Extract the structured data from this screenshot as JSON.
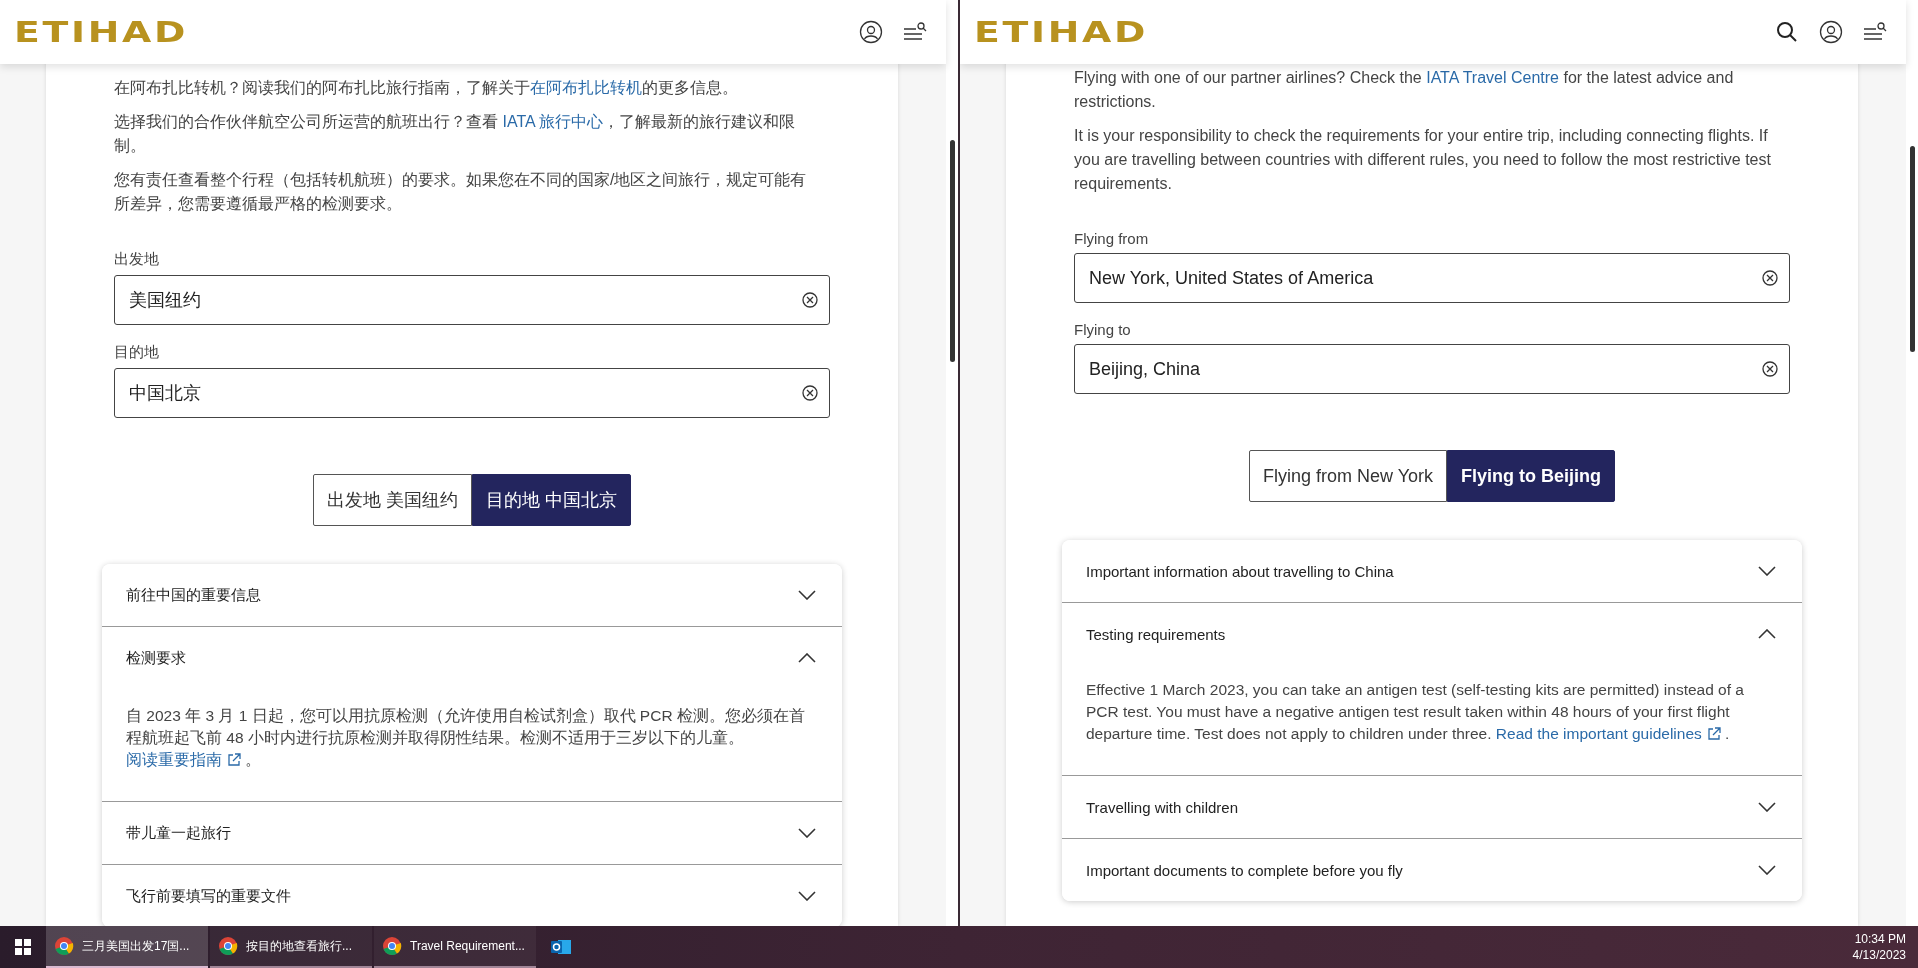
{
  "panes": [
    {
      "logo": "ETIHAD",
      "search_button": false,
      "paragraphs": [
        {
          "parts": [
            {
              "text": "在阿布扎比转机？阅读我们的阿布扎比旅行指南，了解关于",
              "link": false
            },
            {
              "text": "在阿布扎比转机",
              "link": true
            },
            {
              "text": "的更多信息。",
              "link": false
            }
          ]
        },
        {
          "parts": [
            {
              "text": "选择我们的合作伙伴航空公司所运营的航班出行？查看 ",
              "link": false
            },
            {
              "text": "IATA 旅行中心",
              "link": true
            },
            {
              "text": "，了解最新的旅行建议和限制。",
              "link": false
            }
          ]
        },
        {
          "parts": [
            {
              "text": "您有责任查看整个行程（包括转机航班）的要求。如果您在不同的国家/地区之间旅行，规定可能有所差异，您需要遵循最严格的检测要求。",
              "link": false
            }
          ]
        }
      ],
      "fields": [
        {
          "label": "出发地",
          "value": "美国纽约"
        },
        {
          "label": "目的地",
          "value": "中国北京"
        }
      ],
      "toggle": [
        {
          "label": "出发地 美国纽约",
          "selected": false
        },
        {
          "label": "目的地 中国北京",
          "selected": true
        }
      ],
      "accordion": [
        {
          "title": "前往中国的重要信息",
          "expanded": false
        },
        {
          "title": "检测要求",
          "expanded": true,
          "body": [
            {
              "text": "自 2023 年 3 月 1 日起，您可以用抗原检测（允许使用自检试剂盒）取代 PCR 检测。您必须在首程航班起飞前 48 小时内进行抗原检测并取得阴性结果。检测不适用于三岁以下的儿童。",
              "link": false
            },
            {
              "text": "阅读重要指南",
              "link": true,
              "external": true
            },
            {
              "text": " 。",
              "link": false
            }
          ]
        },
        {
          "title": "带儿童一起旅行",
          "expanded": false
        },
        {
          "title": "飞行前要填写的重要文件",
          "expanded": false
        }
      ]
    },
    {
      "logo": "ETIHAD",
      "search_button": true,
      "paragraphs": [
        {
          "parts": [
            {
              "text": "Flying with one of our partner airlines? Check the ",
              "link": false
            },
            {
              "text": "IATA Travel Centre",
              "link": true
            },
            {
              "text": " for the latest advice and restrictions.",
              "link": false
            }
          ]
        },
        {
          "parts": [
            {
              "text": "It is your responsibility to check the requirements for your entire trip, including connecting flights. If you are travelling between countries with different rules, you need to follow the most restrictive test requirements.",
              "link": false
            }
          ]
        }
      ],
      "fields": [
        {
          "label": "Flying from",
          "value": "New York, United States of America"
        },
        {
          "label": "Flying to",
          "value": "Beijing, China"
        }
      ],
      "toggle": [
        {
          "label": "Flying from New York",
          "selected": false
        },
        {
          "label": "Flying to Beijing",
          "selected": true
        }
      ],
      "accordion": [
        {
          "title": "Important information about travelling to China",
          "expanded": false
        },
        {
          "title": "Testing requirements",
          "expanded": true,
          "body": [
            {
              "text": "Effective 1 March 2023, you can take an antigen test (self-testing kits are permitted) instead of a PCR test. You must have a negative antigen test result taken within 48 hours of your first flight departure time. Test does not apply to children under three. ",
              "link": false
            },
            {
              "text": "Read the important guidelines",
              "link": true,
              "external": true
            },
            {
              "text": " .",
              "link": false
            }
          ]
        },
        {
          "title": "Travelling with children",
          "expanded": false
        },
        {
          "title": "Important documents to complete before you fly",
          "expanded": false
        }
      ]
    }
  ],
  "taskbar": {
    "items": [
      {
        "label": "三月美国出发17国...",
        "selected": true
      },
      {
        "label": "按目的地查看旅行...",
        "selected": false
      },
      {
        "label": "Travel Requirement...",
        "selected": false
      }
    ],
    "time": "10:34 PM",
    "date": "4/13/2023"
  }
}
